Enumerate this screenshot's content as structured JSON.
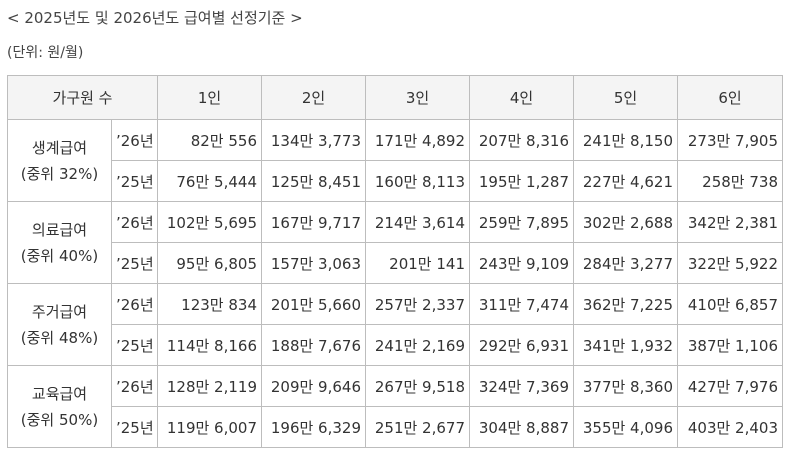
{
  "title": "< 2025년도 및 2026년도 급여별 선정기준 >",
  "unit": "(단위: 원/월)",
  "header": {
    "group_label": "가구원 수",
    "columns": [
      "1인",
      "2인",
      "3인",
      "4인",
      "5인",
      "6인"
    ]
  },
  "rows": [
    {
      "category": "생계급여",
      "criterion": "(중위 32%)",
      "data": [
        {
          "year": "’26년",
          "values": [
            "82만 556",
            "134만 3,773",
            "171만 4,892",
            "207만 8,316",
            "241만 8,150",
            "273만 7,905"
          ]
        },
        {
          "year": "’25년",
          "values": [
            "76만 5,444",
            "125만 8,451",
            "160만 8,113",
            "195만 1,287",
            "227만 4,621",
            "258만 738"
          ]
        }
      ]
    },
    {
      "category": "의료급여",
      "criterion": "(중위 40%)",
      "data": [
        {
          "year": "’26년",
          "values": [
            "102만 5,695",
            "167만 9,717",
            "214만 3,614",
            "259만 7,895",
            "302만 2,688",
            "342만 2,381"
          ]
        },
        {
          "year": "’25년",
          "values": [
            "95만 6,805",
            "157만 3,063",
            "201만 141",
            "243만 9,109",
            "284만 3,277",
            "322만 5,922"
          ]
        }
      ]
    },
    {
      "category": "주거급여",
      "criterion": "(중위 48%)",
      "data": [
        {
          "year": "’26년",
          "values": [
            "123만 834",
            "201만 5,660",
            "257만 2,337",
            "311만 7,474",
            "362만 7,225",
            "410만 6,857"
          ]
        },
        {
          "year": "’25년",
          "values": [
            "114만 8,166",
            "188만 7,676",
            "241만 2,169",
            "292만 6,931",
            "341만 1,932",
            "387만 1,106"
          ]
        }
      ]
    },
    {
      "category": "교육급여",
      "criterion": "(중위 50%)",
      "data": [
        {
          "year": "’26년",
          "values": [
            "128만 2,119",
            "209만 9,646",
            "267만 9,518",
            "324만 7,369",
            "377만 8,360",
            "427만 7,976"
          ]
        },
        {
          "year": "’25년",
          "values": [
            "119만 6,007",
            "196만 6,329",
            "251만 2,677",
            "304만 8,887",
            "355만 4,096",
            "403만 2,403"
          ]
        }
      ]
    }
  ]
}
